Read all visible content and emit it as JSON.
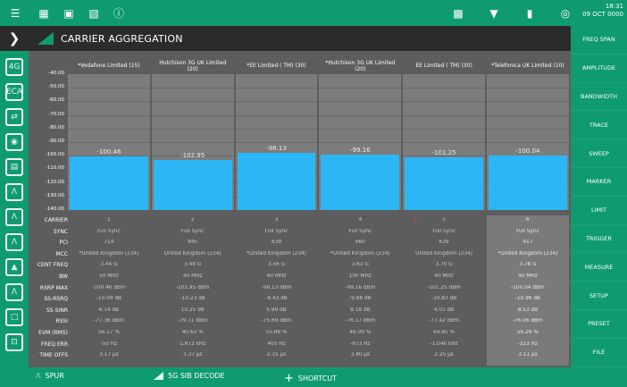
{
  "topbar": {
    "clock_time": "18:31",
    "clock_date": "09 OCT 0000"
  },
  "header": {
    "title": "CARRIER AGGREGATION"
  },
  "rightbar": {
    "items": [
      "FREQ SPAN",
      "AMPLITUDE",
      "BANDWIDTH",
      "TRACE",
      "SWEEP",
      "MARKER",
      "LIMIT",
      "TRIGGER",
      "MEASURE",
      "SETUP",
      "PRESET",
      "FILE"
    ]
  },
  "bottombar": {
    "spur": "SPUR",
    "decode": "5G SIB DECODE",
    "shortcut": "SHORTCUT"
  },
  "colors": {
    "accent": "#0f9b6f",
    "bar": "#2db6f5",
    "panel": "#2b2b2b"
  },
  "icons": {
    "top": [
      "menu-icon",
      "grid-icon",
      "camera-icon",
      "save-icon",
      "info-icon"
    ],
    "top_right": [
      "screen-icon",
      "wifi-icon",
      "battery-icon",
      "gps-icon"
    ]
  },
  "chart_data": {
    "type": "bar",
    "categories": [
      "*Vodafone Limited (15)",
      "Hutchison 3G UK Limited (20)",
      "*EE Limited ( TM) (30)",
      "*Hutchison 3G UK Limited (20)",
      "EE Limited ( TM) (30)",
      "*Telefonica UK Limited (10)"
    ],
    "values": [
      -100.46,
      -102.95,
      -98.13,
      -99.16,
      -101.25,
      -100.04
    ],
    "ylim": [
      -140,
      -40
    ],
    "y_ticks": [
      "-40.00",
      "-50.00",
      "-60.00",
      "-70.00",
      "-80.00",
      "-90.00",
      "-100.00",
      "-110.00",
      "-120.00",
      "-130.00",
      "-140.00"
    ]
  },
  "table": {
    "row_labels": [
      "CARRIER",
      "SYNC",
      "PCI",
      "MCC",
      "CENT FREQ",
      "BW",
      "RSRP MAX",
      "SS-RSRQ",
      "SS-SINR",
      "RSSI",
      "EVM (RMS)",
      "FREQ ERR",
      "TIME OFFS"
    ],
    "columns": [
      [
        "1",
        "Full Sync",
        "714",
        "*United Kingdom (234)",
        "3.44 G",
        "50 MHz",
        "-100.46 dBm",
        "-10.09 dB",
        "6.14 dB",
        "-77.36 dBm",
        "56.17 %",
        "-50 Hz",
        "3.17 µs"
      ],
      [
        "2",
        "Full Sync",
        "945",
        "United Kingdom (234)",
        "3.48 G",
        "40 MHz",
        "-102.95 dBm",
        "-10.23 dB",
        "10.25 dB",
        "-79.71 dBm",
        "40.62 %",
        "1.873 kHz",
        "3.37 µs"
      ],
      [
        "3",
        "Full Sync",
        "639",
        "*United Kingdom (234)",
        "3.56 G",
        "40 MHz",
        "-98.13 dBm",
        "-9.43 dB",
        "5.99 dB",
        "-75.69 dBm",
        "55.88 %",
        "405 Hz",
        "2.15 µs"
      ],
      [
        "4",
        "Full Sync",
        "660",
        "*United Kingdom (234)",
        "3.63 G",
        "100 MHz",
        "-99.16 dBm",
        "-9.98 dB",
        "8.18 dB",
        "-76.17 dBm",
        "46.09 %",
        "-973 Hz",
        "3.40 µs"
      ],
      [
        "5",
        "Full Sync",
        "639",
        "United Kingdom (234)",
        "3.70 G",
        "40 MHz",
        "-101.25 dBm",
        "-10.83 dB",
        "4.01 dB",
        "-77.42 dBm",
        "64.85 %",
        "-1.046 kHz",
        "2.25 µs"
      ],
      [
        "6",
        "Full Sync",
        "417",
        "*United Kingdom (234)",
        "3.78 G",
        "40 MHz",
        "-100.04 dBm",
        "-10.96 dB",
        "8.53 dB",
        "-76.06 dBm",
        "56.26 %",
        "-223 Hz",
        "3.11 µs"
      ]
    ]
  }
}
